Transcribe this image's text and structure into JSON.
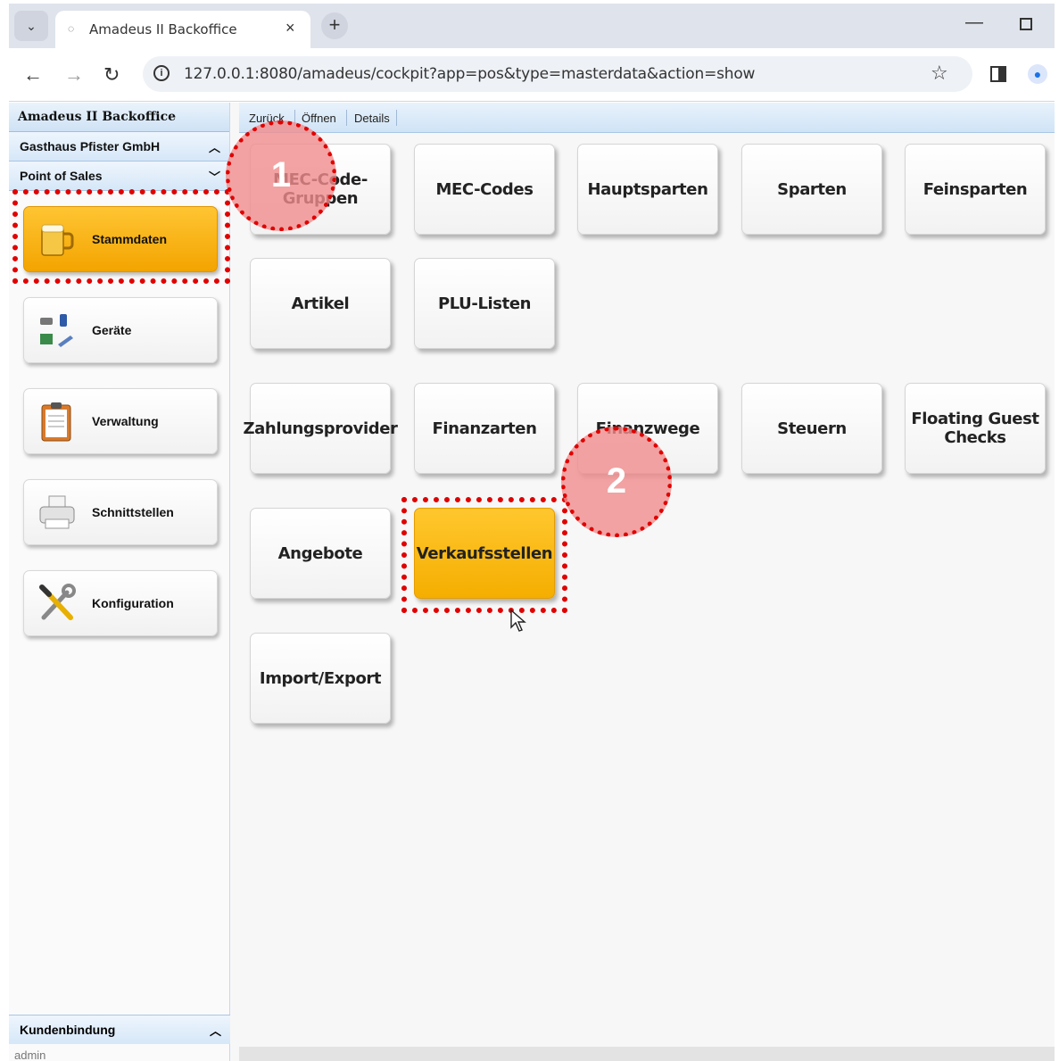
{
  "browser": {
    "tab_title": "Amadeus II Backoffice",
    "url": "127.0.0.1:8080/amadeus/cockpit?app=pos&type=masterdata&action=show"
  },
  "sidebar": {
    "app_title": "Amadeus II Backoffice",
    "company": "Gasthaus Pfister GmbH",
    "section": "Point of Sales",
    "items": [
      {
        "label": "Stammdaten",
        "icon": "beer-mug-icon",
        "active": true
      },
      {
        "label": "Geräte",
        "icon": "devices-icon",
        "active": false
      },
      {
        "label": "Verwaltung",
        "icon": "clipboard-icon",
        "active": false
      },
      {
        "label": "Schnittstellen",
        "icon": "printer-icon",
        "active": false
      },
      {
        "label": "Konfiguration",
        "icon": "tools-icon",
        "active": false
      }
    ],
    "bottom_group": "Kundenbindung",
    "user": "admin"
  },
  "content_toolbar": {
    "items": [
      "Zurück",
      "Öffnen",
      "Details"
    ]
  },
  "tiles": [
    {
      "label": "MEC-Code-Gruppen",
      "active": false
    },
    {
      "label": "MEC-Codes",
      "active": false
    },
    {
      "label": "Hauptsparten",
      "active": false
    },
    {
      "label": "Sparten",
      "active": false
    },
    {
      "label": "Feinsparten",
      "active": false
    },
    {
      "label": "Artikel",
      "active": false
    },
    {
      "label": "PLU-Listen",
      "active": false
    },
    {
      "label": "Zahlungsprovider",
      "active": false
    },
    {
      "label": "Finanzarten",
      "active": false
    },
    {
      "label": "Finanzwege",
      "active": false
    },
    {
      "label": "Steuern",
      "active": false
    },
    {
      "label": "Floating Guest Checks",
      "active": false
    },
    {
      "label": "Angebote",
      "active": false
    },
    {
      "label": "Verkaufsstellen",
      "active": true
    },
    {
      "label": "Import/Export",
      "active": false
    }
  ],
  "annotations": {
    "marker_1": "1",
    "marker_2": "2",
    "color": "#e00000"
  }
}
